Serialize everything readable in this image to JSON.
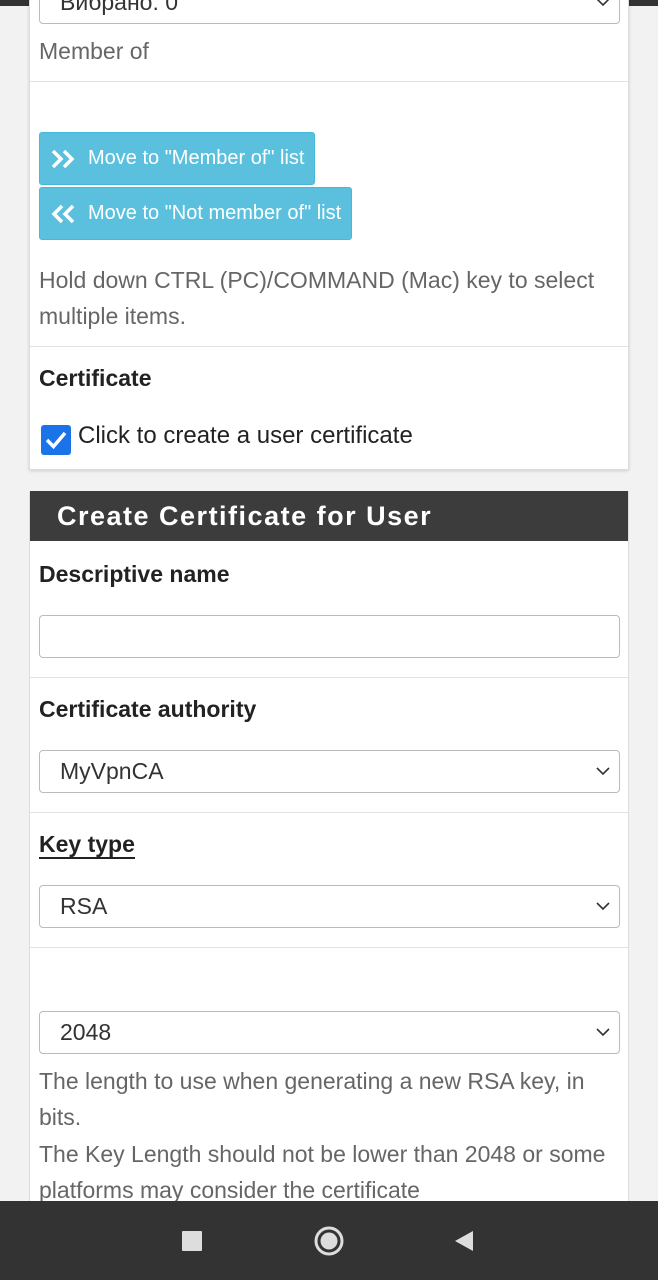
{
  "top_select": {
    "value": "Вибрано: 0"
  },
  "member_of_label": "Member of",
  "buttons": {
    "move_to_member": "Move to \"Member of\" list",
    "move_to_not_member": "Move to \"Not member of\" list"
  },
  "groups_help": "Hold down CTRL (PC)/COMMAND (Mac) key to select multiple items.",
  "certificate": {
    "label": "Certificate",
    "checkbox_label": "Click to create a user certificate",
    "checked": true
  },
  "create_cert": {
    "header": "Create Certificate for User",
    "descriptive_name_label": "Descriptive name",
    "descriptive_name_value": "",
    "ca_label": "Certificate authority",
    "ca_value": "MyVpnCA",
    "key_type_label": "Key type",
    "key_type_value": "RSA",
    "key_length_value": "2048",
    "key_length_help_1": "The length to use when generating a new RSA key, in bits.",
    "key_length_help_2": "The Key Length should not be lower than 2048 or some platforms may consider the certificate"
  },
  "colors": {
    "info_button": "#5bc0de",
    "section_header": "#3c3c3c",
    "checkbox": "#1a73e8",
    "navbar": "#333333"
  },
  "navbar": {
    "icons": [
      "recent-apps-icon",
      "home-icon",
      "back-icon"
    ]
  }
}
